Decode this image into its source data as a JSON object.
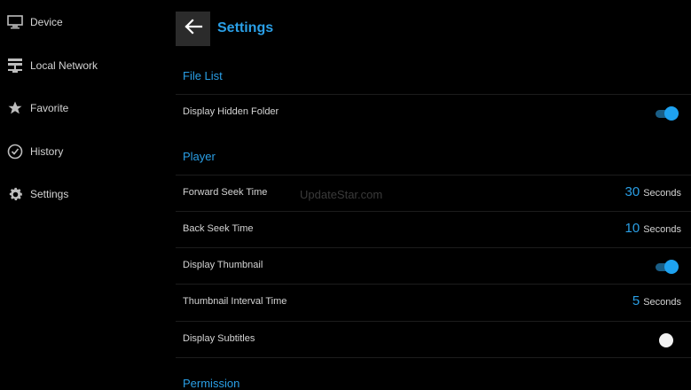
{
  "sidebar": {
    "items": [
      {
        "label": "Device",
        "icon": "monitor-icon"
      },
      {
        "label": "Local Network",
        "icon": "network-icon"
      },
      {
        "label": "Favorite",
        "icon": "star-icon"
      },
      {
        "label": "History",
        "icon": "clock-icon"
      },
      {
        "label": "Settings",
        "icon": "gear-icon"
      }
    ]
  },
  "header": {
    "title": "Settings",
    "back_icon": "arrow-left-icon"
  },
  "sections": {
    "file_list": "File List",
    "player": "Player",
    "permission": "Permission"
  },
  "settings": {
    "display_hidden_folder": {
      "label": "Display Hidden Folder",
      "enabled": true
    },
    "forward_seek": {
      "label": "Forward Seek Time",
      "value": "30",
      "unit": "Seconds"
    },
    "back_seek": {
      "label": "Back Seek Time",
      "value": "10",
      "unit": "Seconds"
    },
    "display_thumbnail": {
      "label": "Display Thumbnail",
      "enabled": true
    },
    "thumbnail_interval": {
      "label": "Thumbnail Interval Time",
      "value": "5",
      "unit": "Seconds"
    },
    "display_subtitles": {
      "label": "Display Subtitles",
      "enabled": false
    }
  },
  "watermark": "UpdateStar.com",
  "colors": {
    "accent": "#2a9fe6",
    "background": "#000000",
    "toggle_on": "#1ea2f0"
  }
}
